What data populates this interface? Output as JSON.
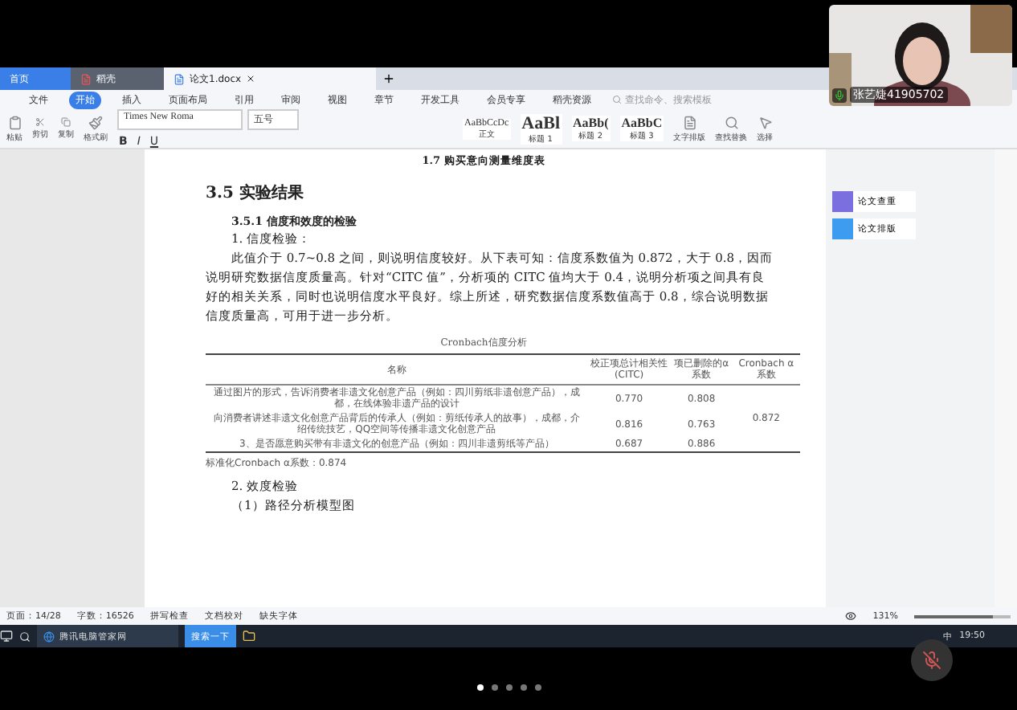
{
  "video_tile": {
    "kind": "picture",
    "name": "张艺婕41905702",
    "mic_on": true
  },
  "tabs": [
    {
      "label": "首页",
      "selected": false,
      "kind": "home"
    },
    {
      "label": "稻壳",
      "selected": false,
      "kind": "doc"
    },
    {
      "label": "论文1.docx",
      "selected": true,
      "kind": "doc"
    }
  ],
  "menu": [
    {
      "label": "文件",
      "selected": false
    },
    {
      "label": "开始",
      "selected": true
    },
    {
      "label": "插入",
      "selected": false
    },
    {
      "label": "页面布局",
      "selected": false
    },
    {
      "label": "引用",
      "selected": false
    },
    {
      "label": "审阅",
      "selected": false
    },
    {
      "label": "视图",
      "selected": false
    },
    {
      "label": "章节",
      "selected": false
    },
    {
      "label": "开发工具",
      "selected": false
    },
    {
      "label": "会员专享",
      "selected": false
    },
    {
      "label": "稻壳资源",
      "selected": false
    }
  ],
  "search": {
    "placeholder": "查找命令、搜索模板"
  },
  "clipboard": [
    {
      "label": "粘贴"
    },
    {
      "label": "剪切"
    },
    {
      "label": "复制"
    },
    {
      "label": "格式刷"
    }
  ],
  "font": {
    "name": "Times New Roma",
    "size": "五号",
    "format_buttons": [
      "B",
      "I",
      "U"
    ]
  },
  "styles": [
    {
      "sample": "AaBbCcDc",
      "label": "正文"
    },
    {
      "sample": "AaBl",
      "label": "标题 1"
    },
    {
      "sample": "AaBb(",
      "label": "标题 2"
    },
    {
      "sample": "AaBbC",
      "label": "标题 3"
    }
  ],
  "tools": [
    {
      "label": "文字排版"
    },
    {
      "label": "查找替换"
    },
    {
      "label": "选择"
    }
  ],
  "document": {
    "caption": "1.7 购买意向测量维度表",
    "heading": "3.5 实验结果",
    "subheading": "3.5.1 信度和效度的检验",
    "item_1": "1. 信度检验：",
    "paragraph": "此值介于 0.7~0.8 之间，则说明信度较好。从下表可知：信度系数值为 0.872，大于 0.8，因而说明研究数据信度质量高。针对“CITC 值”，分析项的 CITC 值均大于 0.4，说明分析项之间具有良好的相关关系，同时也说明信度水平良好。综上所述，研究数据信度系数值高于 0.8，综合说明数据信度质量高，可用于进一步分析。",
    "table": {
      "title": "Cronbach信度分析",
      "columns": [
        "名称",
        "校正项总计相关性(CITC)",
        "项已删除的α系数",
        "Cronbach α系数"
      ],
      "rows": [
        [
          "通过图片的形式，告诉消费者非遗文化创意产品（例如：四川剪纸非遗创意产品），成都，在线体验非遗产品的设计",
          "0.770",
          "0.808"
        ],
        [
          "向消费者讲述非遗文化创意产品背后的传承人（例如：剪纸传承人的故事），成都，介绍传统技艺，QQ空间等传播非遗文化创意产品",
          "0.816",
          "0.763"
        ],
        [
          "3、是否愿意购买带有非遗文化的创意产品（例如：四川非遗剪纸等产品）",
          "0.687",
          "0.886"
        ]
      ],
      "overall": "0.872",
      "footnote": "标准化Cronbach α系数：0.874"
    },
    "item_2": "2. 效度检验",
    "item_3": "（1）路径分析模型图"
  },
  "side_panel": [
    {
      "label": "论文查重",
      "color": "#7b6fe0"
    },
    {
      "label": "论文排版",
      "color": "#3d9cf0"
    }
  ],
  "status_bar": {
    "page": "页面：14/28",
    "words": "字数：16526",
    "spell": "拼写检查",
    "proof": "文档校对",
    "fonts": "缺失字体",
    "zoom": "131%",
    "level": 0.82
  },
  "taskbar": {
    "app": "腾讯电脑管家网",
    "search": "搜索一下",
    "ime": "中",
    "time": "19:50"
  },
  "pager": [
    {
      "selected": true
    },
    {
      "selected": false
    },
    {
      "selected": false
    },
    {
      "selected": false
    },
    {
      "selected": false
    }
  ]
}
